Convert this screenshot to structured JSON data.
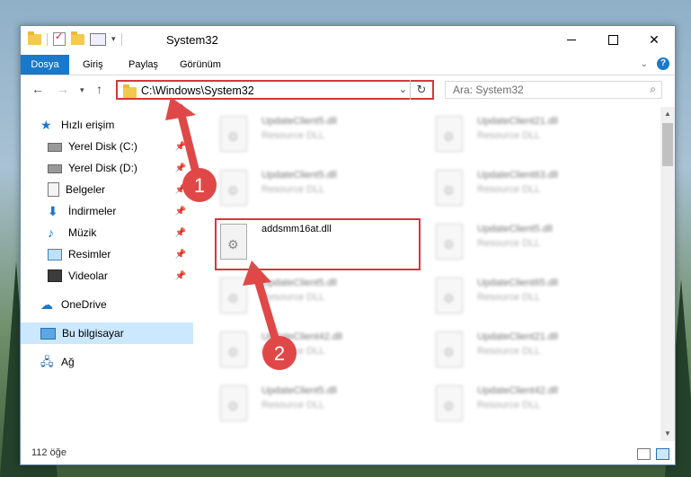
{
  "window": {
    "title": "System32"
  },
  "ribbon": {
    "tabs": [
      "Dosya",
      "Giriş",
      "Paylaş",
      "Görünüm"
    ]
  },
  "address": {
    "path": "C:\\Windows\\System32",
    "search_placeholder": "Ara: System32"
  },
  "sidebar": {
    "items": [
      {
        "label": "Hızlı erişim",
        "icon": "star-icon",
        "pinned": false
      },
      {
        "label": "Yerel Disk (C:)",
        "icon": "drive-icon",
        "pinned": true
      },
      {
        "label": "Yerel Disk (D:)",
        "icon": "drive-icon",
        "pinned": true
      },
      {
        "label": "Belgeler",
        "icon": "documents-icon",
        "pinned": true
      },
      {
        "label": "İndirmeler",
        "icon": "download-icon",
        "pinned": true
      },
      {
        "label": "Müzik",
        "icon": "music-icon",
        "pinned": true
      },
      {
        "label": "Resimler",
        "icon": "pictures-icon",
        "pinned": true
      },
      {
        "label": "Videolar",
        "icon": "videos-icon",
        "pinned": true
      },
      {
        "label": "OneDrive",
        "icon": "cloud-icon",
        "pinned": false
      },
      {
        "label": "Bu bilgisayar",
        "icon": "computer-icon",
        "pinned": false,
        "selected": true
      },
      {
        "label": "Ağ",
        "icon": "network-icon",
        "pinned": false
      }
    ]
  },
  "files": {
    "col1": [
      {
        "name": "UpdateClient5.dll",
        "type": "Resource DLL"
      },
      {
        "name": "UpdateClient5.dll",
        "type": "Resource DLL"
      },
      {
        "name": "addsmm16at.dll",
        "type": ""
      },
      {
        "name": "UpdateClient5.dll",
        "type": "Resource DLL"
      },
      {
        "name": "UpdateClient42.dll",
        "type": "Resource DLL"
      },
      {
        "name": "UpdateClient5.dll",
        "type": "Resource DLL"
      }
    ],
    "col2": [
      {
        "name": "UpdateClient21.dll",
        "type": "Resource DLL"
      },
      {
        "name": "UpdateClient63.dll",
        "type": "Resource DLL"
      },
      {
        "name": "UpdateClient5.dll",
        "type": "Resource DLL"
      },
      {
        "name": "UpdateClient65.dll",
        "type": "Resource DLL"
      },
      {
        "name": "UpdateClient21.dll",
        "type": "Resource DLL"
      },
      {
        "name": "UpdateClient42.dll",
        "type": "Resource DLL"
      }
    ]
  },
  "status": {
    "count": "112 öğe"
  },
  "annotations": {
    "badge1": "1",
    "badge2": "2",
    "color": "#d6363d"
  }
}
